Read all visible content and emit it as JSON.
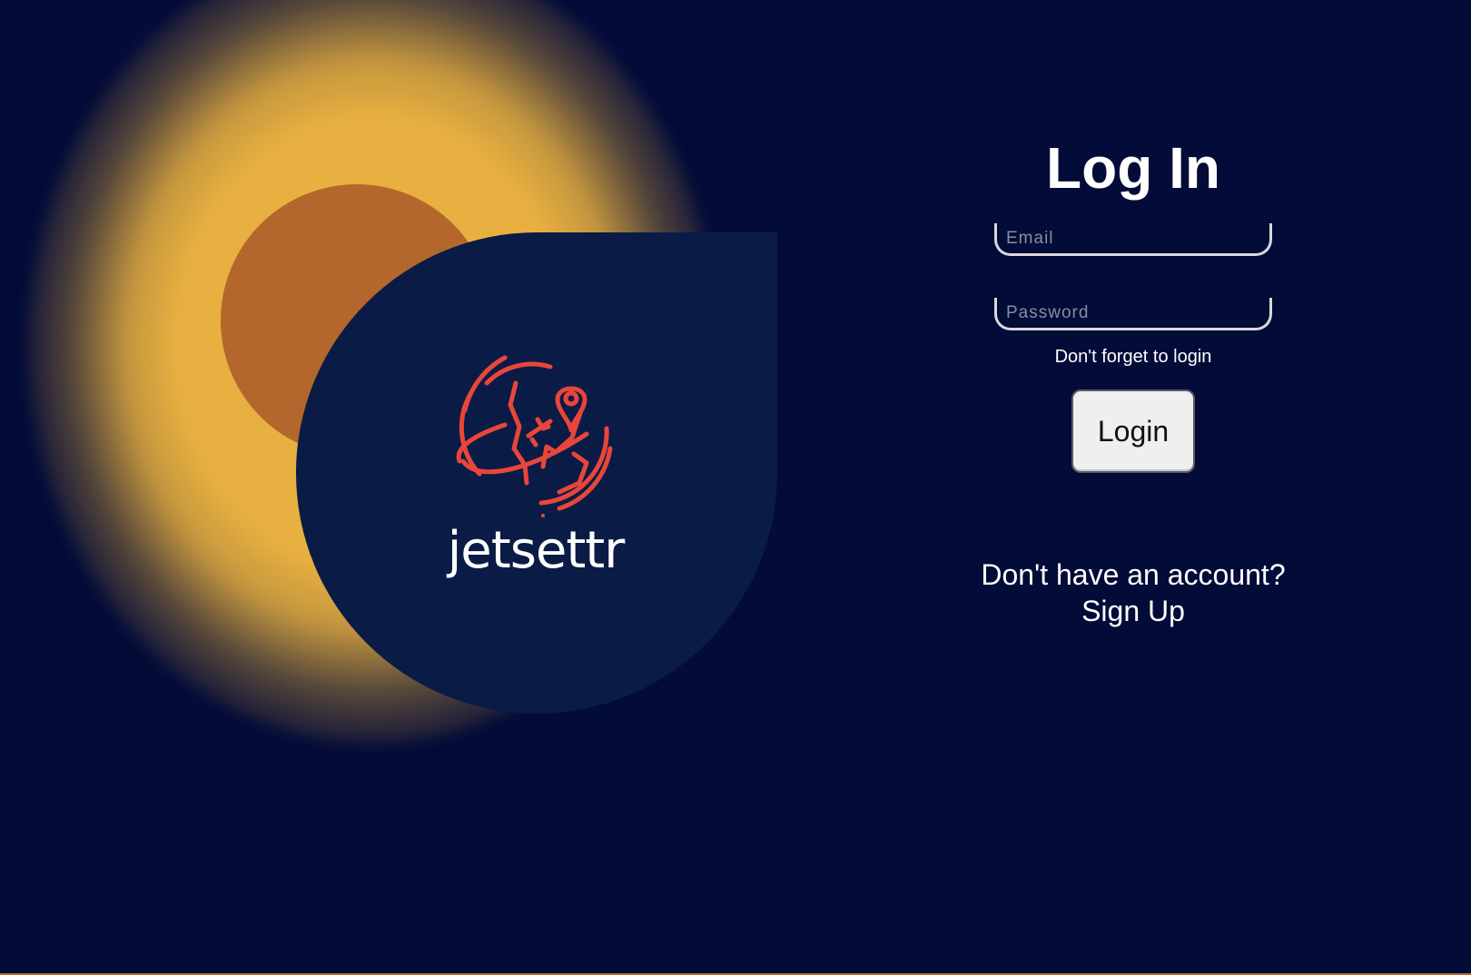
{
  "brand": {
    "name": "jetsettr",
    "logo_icon": "globe-plane-pin-icon",
    "logo_color": "#e8463a"
  },
  "colors": {
    "background": "#030b38",
    "glow": "#e8b040",
    "sun": "#b3672d",
    "card": "#0a1c46"
  },
  "login": {
    "title": "Log In",
    "email_placeholder": "Email",
    "password_placeholder": "Password",
    "hint": "Don't forget to login",
    "button_label": "Login",
    "signup_prompt": "Don't have an account?",
    "signup_link": "Sign Up"
  }
}
